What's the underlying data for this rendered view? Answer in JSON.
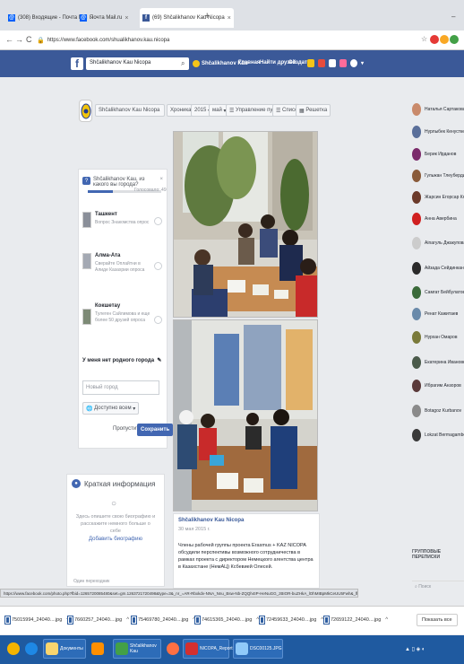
{
  "browser": {
    "tabs": [
      {
        "label": "(308) Входящие - Почта Mai",
        "icon": "mail-icon"
      },
      {
        "label": "Почта Mail.ru",
        "icon": "mail-icon"
      },
      {
        "label": "(69) Shčalikhanov Kau Nicopa",
        "icon": "facebook-icon",
        "active": true
      }
    ],
    "url": "https://www.facebook.com/shualikhanov.kau.nicopa",
    "status_url": "https://www.facebook.com/photo.php?fbid=1265720085480&set=gm.1263721720498&type=3&_nr_=AR-Rbxkdv-NNA_Nnu_Bsw-Nb-ZQQh4IP-HeNuGG_zBIOR-buZHkA_lOhMIBpMkCeUU5Fwh&_fb_fc=pdl0"
  },
  "facebook": {
    "search_value": "Shčalikhanov Kau Nicopa",
    "nav": {
      "profile": "Shčalikhanov Kau",
      "home": "Главная",
      "find_friends": "Найти друзей",
      "create": "Создать"
    },
    "colors": {
      "brand": "#3b5998",
      "button": "#4267b2"
    }
  },
  "group_header": {
    "name": "Shčalikhanov Kau Nicopa",
    "chronicle": "Хроника",
    "year": "2015",
    "month": "май",
    "manage_posts": "Управление публикациями",
    "list_view": "Список",
    "grid_view": "Решетка"
  },
  "poll": {
    "question": "Shčalikhanov Kau, из какого вы города?",
    "votes": "Голосовало: 49",
    "progress_percent": 34,
    "options": [
      {
        "title": "Ташкент",
        "desc": "Вопрос Знакомства опрос"
      },
      {
        "title": "Алма-Ата",
        "desc": "Сверайте Оплайтни в Алиде Казахрии опроса"
      },
      {
        "title": "Кокшетау",
        "desc": "Тулеген Сайлимова и еще более 50 друзей опроса"
      }
    ],
    "home_city_label": "У меня нет родного города",
    "city_placeholder": "Новый город",
    "privacy": "Доступно всем",
    "skip": "Пропустить",
    "save": "Сохранить"
  },
  "info": {
    "title": "Краткая информация",
    "text": "Здесь опишите свою биографию и расскажите немного больше о себе",
    "add_link": "Добавить биографию",
    "more": "Один переходник"
  },
  "post": {
    "author": "Shčalikhanov Kau Nicopa",
    "date": "30 мая 2015 г.",
    "text": "Члены рабочей группы проекта Erasmus + KAZ NICOPA обсудили перспективы возможного сотрудничества в рамках проекта с директором Немецкого агентства центра в Казахстане (НемАЦ) Ксбевией Олесей."
  },
  "contacts": [
    {
      "name": "Наталья Сартакова",
      "color": "#c98a6b"
    },
    {
      "name": "Нурлыбек Кенусткев",
      "color": "#5a6f9a"
    },
    {
      "name": "Берик Ирданов",
      "color": "#7a2a6a"
    },
    {
      "name": "Гульжан Тлеубердина",
      "color": "#8a5b3a"
    },
    {
      "name": "Жарсин Егорсар Кя",
      "color": "#6b3a2a"
    },
    {
      "name": "Анна Авербина",
      "color": "#d02020"
    },
    {
      "name": "Ainагуль Джакупова",
      "color": "#cccccc"
    },
    {
      "name": "Айзада Сейдинкан",
      "color": "#2a2a2a"
    },
    {
      "name": "Самгат Бейбулатов",
      "color": "#3a6a3a"
    },
    {
      "name": "Ренат Кажитаев",
      "color": "#6a8aaa"
    },
    {
      "name": "Нурхан Омаров",
      "color": "#7a7a3a"
    },
    {
      "name": "Екатерина Ивановна",
      "color": "#4a5a4a"
    },
    {
      "name": "Ибрагим Анзоров",
      "color": "#5a3a3a"
    },
    {
      "name": "Botagoz Kurbanov",
      "color": "#8a8a8a"
    },
    {
      "name": "Lokzat Bermagambet",
      "color": "#3a3a3a"
    }
  ],
  "chat": {
    "more_contacts": "ГРУППОВЫЕ ПЕРЕПИСКИ",
    "search": "Поиск"
  },
  "downloads": {
    "items": [
      "75015994_24040....jpg",
      "7660257_24040....jpg",
      "75469780_24040....jpg",
      "74615365_24040....jpg",
      "72459633_24040....jpg",
      "72659122_24040....jpg"
    ],
    "show_all": "Показать все"
  },
  "taskbar": {
    "items": [
      "Документы",
      "Shčalikhanov Kau",
      "NICOPA_Report...",
      "DSC00125.JPG"
    ]
  }
}
